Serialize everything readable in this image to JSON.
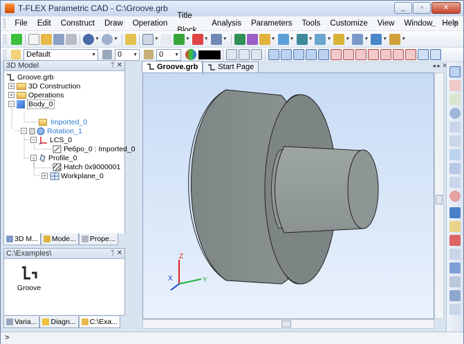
{
  "window": {
    "title": "T-FLEX Parametric CAD - C:\\Groove.grb",
    "buttons": [
      "_",
      "▫",
      "✕"
    ]
  },
  "menu": [
    "File",
    "Edit",
    "Construct",
    "Draw",
    "Operation",
    "Title Block",
    "Analysis",
    "Parameters",
    "Tools",
    "Customize",
    "View",
    "Window",
    "Help"
  ],
  "toolbar2": {
    "layer_value": "Default",
    "level_value": "0",
    "priority_value": "0"
  },
  "model_panel": {
    "title": "3D Model",
    "tree": {
      "root": "Groove.grb",
      "construction": "3D Construction",
      "operations": "Operations",
      "body": "Body_0",
      "imported": "Imported_0",
      "rotation": "Rotation_1",
      "lcs": "LCS_0",
      "edge": "Ребро_0 : Imported_0",
      "profile": "Profile_0",
      "hatch": "Hatch 0x9000001",
      "workplane": "Workplane_0"
    },
    "tabs": [
      "3D M...",
      "Mode...",
      "Prope..."
    ]
  },
  "examples_panel": {
    "title": "C:\\Examples\\",
    "item": "Groove",
    "tabs": [
      "Varia...",
      "Diagn...",
      "C:\\Exa..."
    ]
  },
  "doc_tabs": [
    "Groove.grb",
    "Start Page"
  ],
  "axes": {
    "x": "X",
    "y": "Y",
    "z": "Z"
  },
  "status": {
    "text": ">"
  },
  "colors": {
    "accent": "#2a7ad4",
    "viewport_top": "#c8dbf5",
    "viewport_bottom": "#e9f1fc",
    "part": "#7d8484"
  }
}
